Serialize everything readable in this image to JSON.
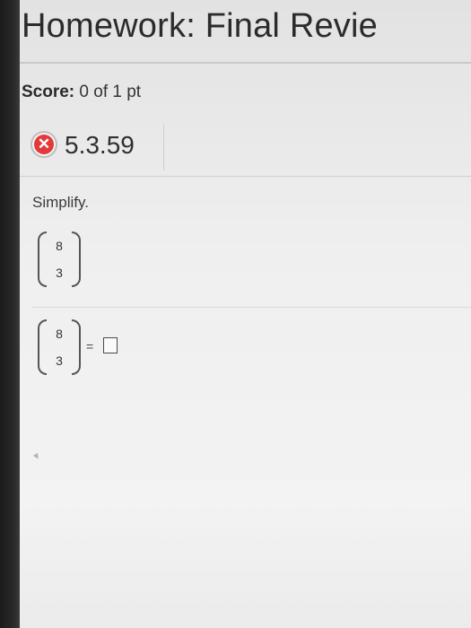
{
  "header": {
    "title": "Homework: Final Revie"
  },
  "score": {
    "label": "Score:",
    "value": "0 of 1 pt"
  },
  "question": {
    "number": "5.3.59",
    "status_icon": "x-circle-icon",
    "status_color": "#e23a3a"
  },
  "problem": {
    "instruction": "Simplify.",
    "example_binom": {
      "n": "8",
      "k": "3"
    },
    "answer_binom": {
      "n": "8",
      "k": "3"
    },
    "equals": "="
  },
  "colors": {
    "wrong": "#e23a3a"
  }
}
